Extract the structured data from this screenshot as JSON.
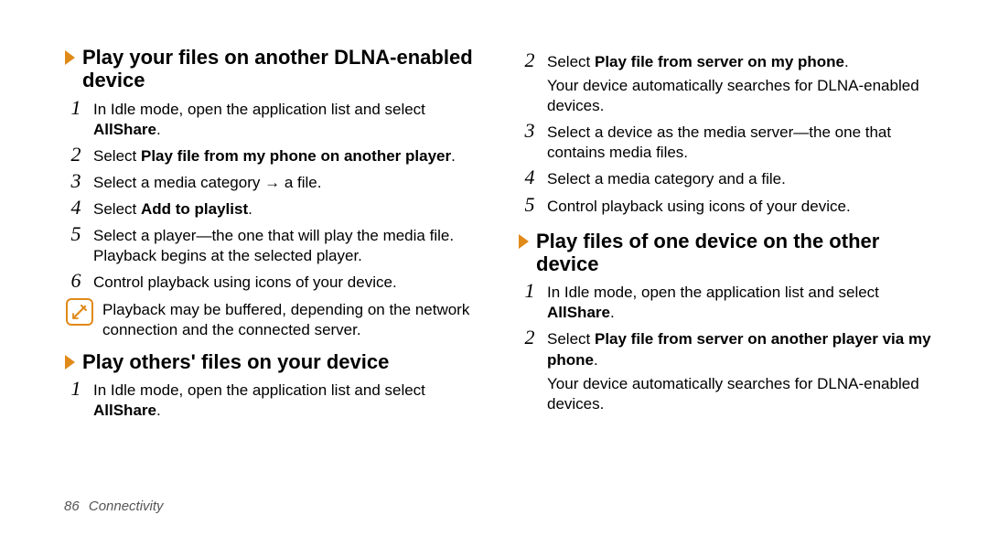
{
  "left": {
    "section1": {
      "title": "Play your files on another DLNA-enabled device",
      "steps": [
        {
          "num": "1",
          "pre": "In Idle mode, open the application list and select ",
          "bold": "AllShare",
          "post": "."
        },
        {
          "num": "2",
          "pre": "Select ",
          "bold": "Play file from my phone on another player",
          "post": "."
        },
        {
          "num": "3",
          "pre": "Select a media category → a file.",
          "bold": "",
          "post": ""
        },
        {
          "num": "4",
          "pre": "Select ",
          "bold": "Add to playlist",
          "post": "."
        },
        {
          "num": "5",
          "pre": "Select a player—the one that will play the media file. Playback begins at the selected player.",
          "bold": "",
          "post": ""
        },
        {
          "num": "6",
          "pre": "Control playback using icons of your device.",
          "bold": "",
          "post": ""
        }
      ],
      "note": "Playback may be buffered, depending on the network connection and the connected server."
    },
    "section2": {
      "title": "Play others' files on your device",
      "steps": [
        {
          "num": "1",
          "pre": "In Idle mode, open the application list and select ",
          "bold": "AllShare",
          "post": "."
        }
      ]
    }
  },
  "right": {
    "top_steps": [
      {
        "num": "2",
        "pre": "Select ",
        "bold": "Play file from server on my phone",
        "post": ".",
        "sub": "Your device automatically searches for DLNA-enabled devices."
      },
      {
        "num": "3",
        "pre": "Select a device as the media server—the one that contains media files.",
        "bold": "",
        "post": "",
        "sub": ""
      },
      {
        "num": "4",
        "pre": "Select a media category and a file.",
        "bold": "",
        "post": "",
        "sub": ""
      },
      {
        "num": "5",
        "pre": "Control playback using icons of your device.",
        "bold": "",
        "post": "",
        "sub": ""
      }
    ],
    "section3": {
      "title": "Play files of one device on the other device",
      "steps": [
        {
          "num": "1",
          "pre": "In Idle mode, open the application list and select ",
          "bold": "AllShare",
          "post": ".",
          "sub": ""
        },
        {
          "num": "2",
          "pre": "Select ",
          "bold": "Play file from server on another player via my phone",
          "post": ".",
          "sub": "Your device automatically searches for DLNA-enabled devices."
        }
      ]
    }
  },
  "footer": {
    "page": "86",
    "section": "Connectivity"
  }
}
